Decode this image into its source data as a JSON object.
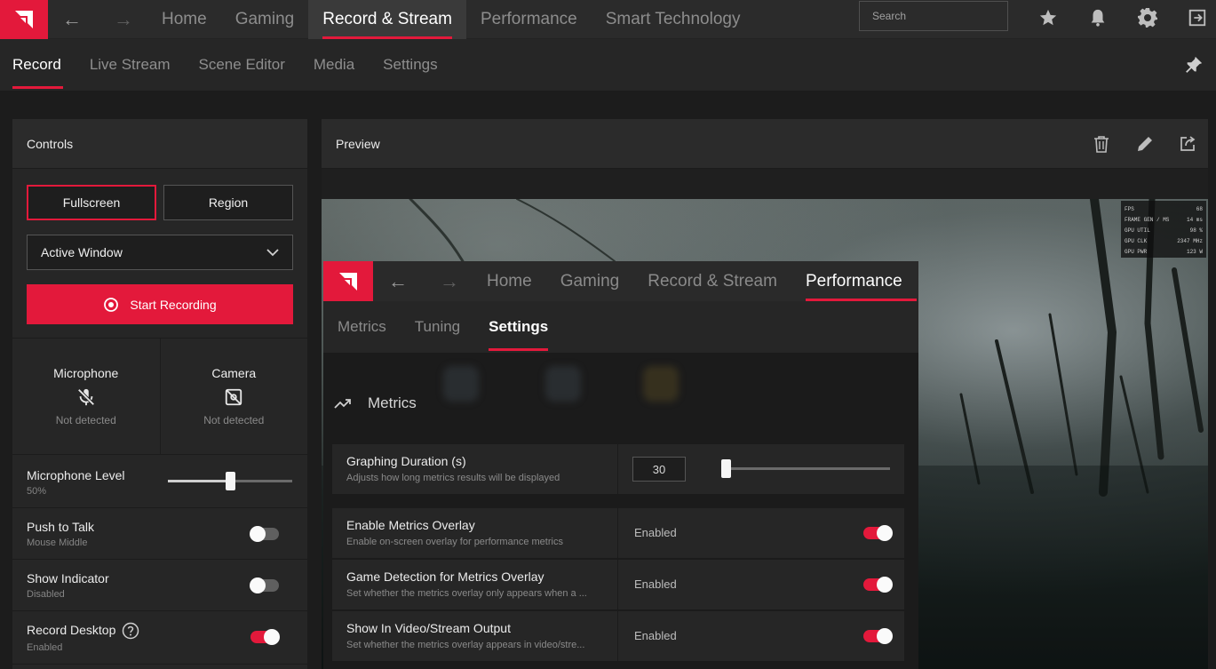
{
  "topbar": {
    "nav": [
      "Home",
      "Gaming",
      "Record & Stream",
      "Performance",
      "Smart Technology"
    ],
    "active_nav": "Record & Stream",
    "search_placeholder": "Search"
  },
  "subnav": {
    "items": [
      "Record",
      "Live Stream",
      "Scene Editor",
      "Media",
      "Settings"
    ],
    "active": "Record"
  },
  "controls": {
    "title": "Controls",
    "fullscreen_label": "Fullscreen",
    "region_label": "Region",
    "capture_target": "Active Window",
    "start_recording_label": "Start Recording",
    "microphone": {
      "title": "Microphone",
      "status": "Not detected"
    },
    "camera": {
      "title": "Camera",
      "status": "Not detected"
    },
    "mic_level": {
      "label": "Microphone Level",
      "value": "50%",
      "fraction": 0.5
    },
    "push_to_talk": {
      "label": "Push to Talk",
      "value": "Mouse Middle",
      "on": false
    },
    "show_indicator": {
      "label": "Show Indicator",
      "value": "Disabled",
      "on": false
    },
    "record_desktop": {
      "label": "Record Desktop",
      "value": "Enabled",
      "on": true
    }
  },
  "preview": {
    "title": "Preview",
    "overlay_stats": [
      {
        "label": "FPS",
        "value": "68"
      },
      {
        "label": "FRAME GEN / MS",
        "value": "14 ms"
      },
      {
        "label": "GPU UTIL",
        "value": "98 %"
      },
      {
        "label": "GPU CLK",
        "value": "2347 MHz"
      },
      {
        "label": "GPU PWR",
        "value": "123 W"
      }
    ],
    "nested": {
      "nav": [
        "Home",
        "Gaming",
        "Record & Stream",
        "Performance"
      ],
      "active_nav": "Performance",
      "subnav": [
        "Metrics",
        "Tuning",
        "Settings"
      ],
      "active_sub": "Settings",
      "section_title": "Metrics",
      "graphing": {
        "title": "Graphing Duration (s)",
        "desc": "Adjusts how long metrics results will be displayed",
        "value": "30"
      },
      "rows": [
        {
          "title": "Enable Metrics Overlay",
          "desc": "Enable on-screen overlay for performance metrics",
          "value": "Enabled"
        },
        {
          "title": "Game Detection for Metrics Overlay",
          "desc": "Set whether the metrics overlay only appears when a ...",
          "value": "Enabled"
        },
        {
          "title": "Show In Video/Stream Output",
          "desc": "Set whether the metrics overlay appears in video/stre...",
          "value": "Enabled"
        }
      ]
    }
  },
  "colors": {
    "accent": "#e3193b",
    "panel": "#262626",
    "topbar": "#2b2b2b"
  }
}
